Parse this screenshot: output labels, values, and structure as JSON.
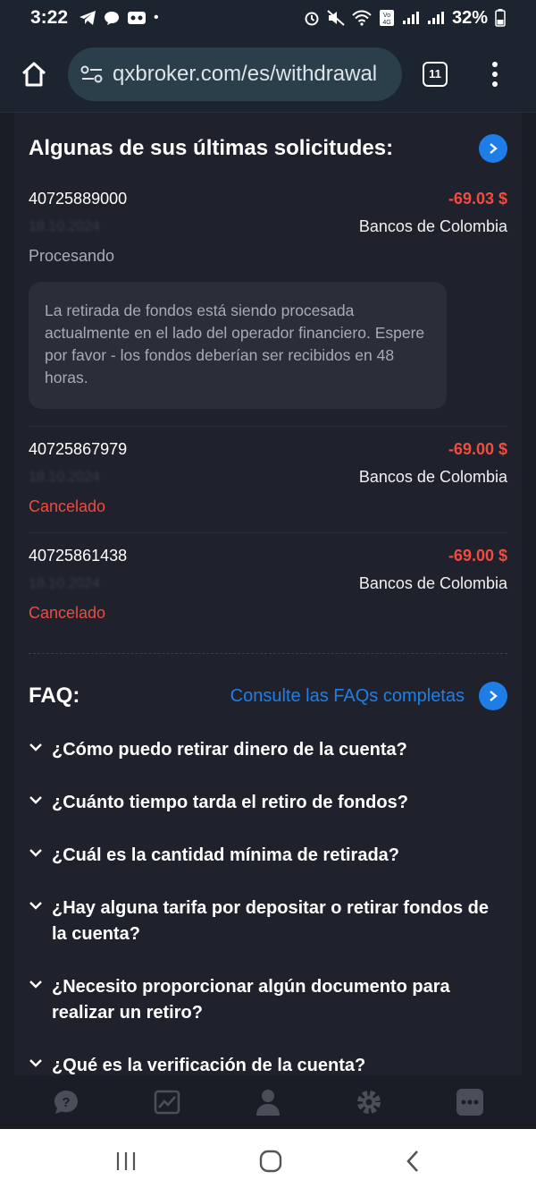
{
  "status_bar": {
    "time": "3:22",
    "battery": "32%"
  },
  "browser": {
    "url": "qxbroker.com/es/withdrawal",
    "tab_count": "11"
  },
  "requests": {
    "title": "Algunas de sus últimas solicitudes:",
    "items": [
      {
        "id": "40725889000",
        "amount": "-69.03 $",
        "date": "18.10.2024",
        "bank": "Bancos de Colombia",
        "status": "Procesando",
        "note": "La retirada de fondos está siendo procesada actualmente en el lado del operador financiero. Espere por favor - los fondos deberían ser recibidos en 48 horas."
      },
      {
        "id": "40725867979",
        "amount": "-69.00 $",
        "date": "18.10.2024",
        "bank": "Bancos de Colombia",
        "status": "Cancelado"
      },
      {
        "id": "40725861438",
        "amount": "-69.00 $",
        "date": "18.10.2024",
        "bank": "Bancos de Colombia",
        "status": "Cancelado"
      }
    ]
  },
  "faq": {
    "title": "FAQ:",
    "link": "Consulte las FAQs completas",
    "questions": [
      "¿Cómo puedo retirar dinero de la cuenta?",
      "¿Cuánto tiempo tarda el retiro de fondos?",
      "¿Cuál es la cantidad mínima de retirada?",
      "¿Hay alguna tarifa por depositar o retirar fondos de la cuenta?",
      "¿Necesito proporcionar algún documento para realizar un retiro?",
      "¿Qué es la verificación de la cuenta?"
    ]
  },
  "colors": {
    "accent": "#1e7ee6",
    "negative": "#f24b3f",
    "background": "#1f222c"
  },
  "icons": {
    "bottom_nav": [
      "help-icon",
      "chart-icon",
      "profile-icon",
      "settings-icon",
      "more-icon"
    ]
  }
}
